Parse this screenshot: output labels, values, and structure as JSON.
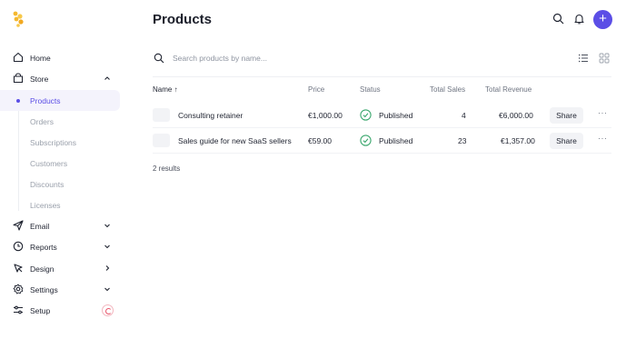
{
  "sidebar": {
    "items": [
      {
        "label": "Home",
        "icon": "home-icon"
      },
      {
        "label": "Store",
        "icon": "store-icon"
      },
      {
        "label": "Email",
        "icon": "send-icon"
      },
      {
        "label": "Reports",
        "icon": "clock-icon"
      },
      {
        "label": "Design",
        "icon": "cursor-icon"
      },
      {
        "label": "Settings",
        "icon": "gear-icon"
      },
      {
        "label": "Setup",
        "icon": "sliders-icon"
      }
    ],
    "store_sub": [
      "Products",
      "Orders",
      "Subscriptions",
      "Customers",
      "Discounts",
      "Licenses"
    ]
  },
  "header": {
    "title": "Products"
  },
  "search": {
    "placeholder": "Search products by name..."
  },
  "table": {
    "columns": [
      "Name ↑",
      "Price",
      "Status",
      "Total Sales",
      "Total Revenue"
    ],
    "rows": [
      {
        "name": "Consulting retainer",
        "price": "€1,000.00",
        "status": "Published",
        "sales": "4",
        "revenue": "€6,000.00",
        "action": "Share",
        "more": "···"
      },
      {
        "name": "Sales guide for new SaaS sellers",
        "price": "€59.00",
        "status": "Published",
        "sales": "23",
        "revenue": "€1,357.00",
        "action": "Share",
        "more": "···"
      }
    ],
    "results": "2 results"
  },
  "colors": {
    "accent": "#5b4ee6",
    "status_green": "#3aa76d",
    "logo_yellow": "#f5b82e"
  }
}
